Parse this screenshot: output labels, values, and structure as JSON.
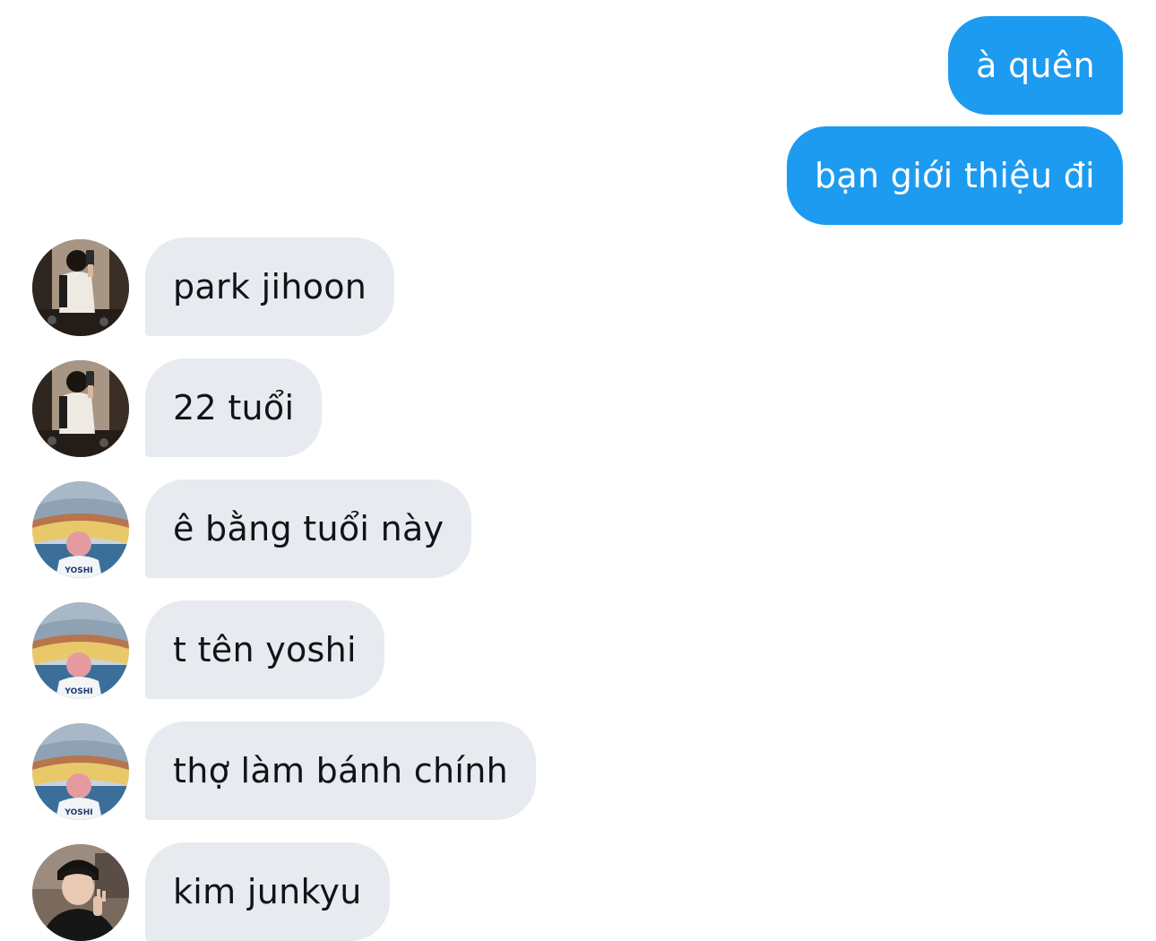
{
  "conversation": {
    "messages": [
      {
        "direction": "sent",
        "text": "à quên"
      },
      {
        "direction": "sent",
        "text": "bạn giới thiệu đi"
      },
      {
        "direction": "received",
        "sender_avatar": "avatar-photo-mirror-selfie",
        "text": "park jihoon"
      },
      {
        "direction": "received",
        "sender_avatar": "avatar-photo-mirror-selfie",
        "text": "22 tuổi"
      },
      {
        "direction": "received",
        "sender_avatar": "avatar-photo-stadium",
        "text": "ê bằng tuổi này"
      },
      {
        "direction": "received",
        "sender_avatar": "avatar-photo-stadium",
        "text": "t tên yoshi"
      },
      {
        "direction": "received",
        "sender_avatar": "avatar-photo-stadium",
        "text": "thợ làm bánh chính"
      },
      {
        "direction": "received",
        "sender_avatar": "avatar-photo-portrait",
        "text": "kim junkyu"
      }
    ],
    "avatar_jersey_text": "YOSHI"
  },
  "colors": {
    "sent_bubble": "#1d9bf0",
    "sent_text": "#ffffff",
    "received_bubble": "#e7ebef",
    "received_text": "#0f1419",
    "background": "#ffffff"
  }
}
